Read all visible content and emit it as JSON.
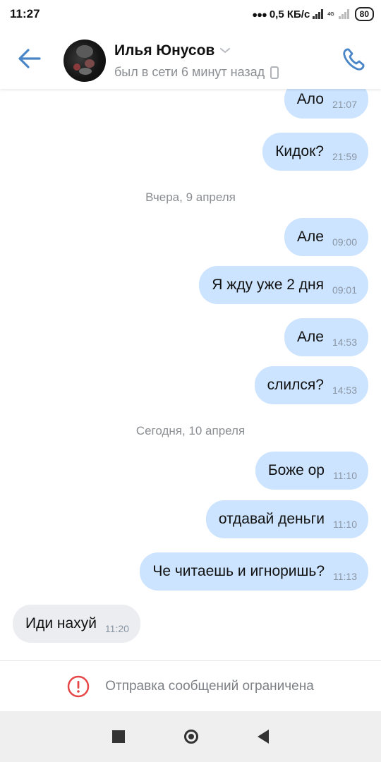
{
  "status_bar": {
    "time": "11:27",
    "net_speed": "0,5 КБ/с",
    "net_type": "4G",
    "battery": "80"
  },
  "header": {
    "name": "Илья Юнусов",
    "status": "был в сети 6 минут назад"
  },
  "messages": [
    {
      "dir": "out",
      "text": "Ало",
      "time": "21:07"
    },
    {
      "dir": "out",
      "text": "Кидок?",
      "time": "21:59"
    },
    {
      "dir": "date",
      "text": "Вчера, 9 апреля"
    },
    {
      "dir": "out",
      "text": "Але",
      "time": "09:00"
    },
    {
      "dir": "out",
      "text": "Я жду уже 2 дня",
      "time": "09:01"
    },
    {
      "dir": "out",
      "text": "Але",
      "time": "14:53"
    },
    {
      "dir": "out",
      "text": "слился?",
      "time": "14:53"
    },
    {
      "dir": "date",
      "text": "Сегодня, 10 апреля"
    },
    {
      "dir": "out",
      "text": "Боже ор",
      "time": "11:10"
    },
    {
      "dir": "out",
      "text": "отдавай деньги",
      "time": "11:10"
    },
    {
      "dir": "out",
      "text": "Че читаешь и игноришь?",
      "time": "11:13"
    },
    {
      "dir": "in",
      "text": "Иди нахуй",
      "time": "11:20"
    }
  ],
  "restriction": {
    "text": "Отправка сообщений ограничена"
  },
  "colors": {
    "accent": "#4a86c7",
    "outgoing_bubble": "#cce4ff",
    "incoming_bubble": "#ebedf0",
    "warning": "#e64646"
  }
}
